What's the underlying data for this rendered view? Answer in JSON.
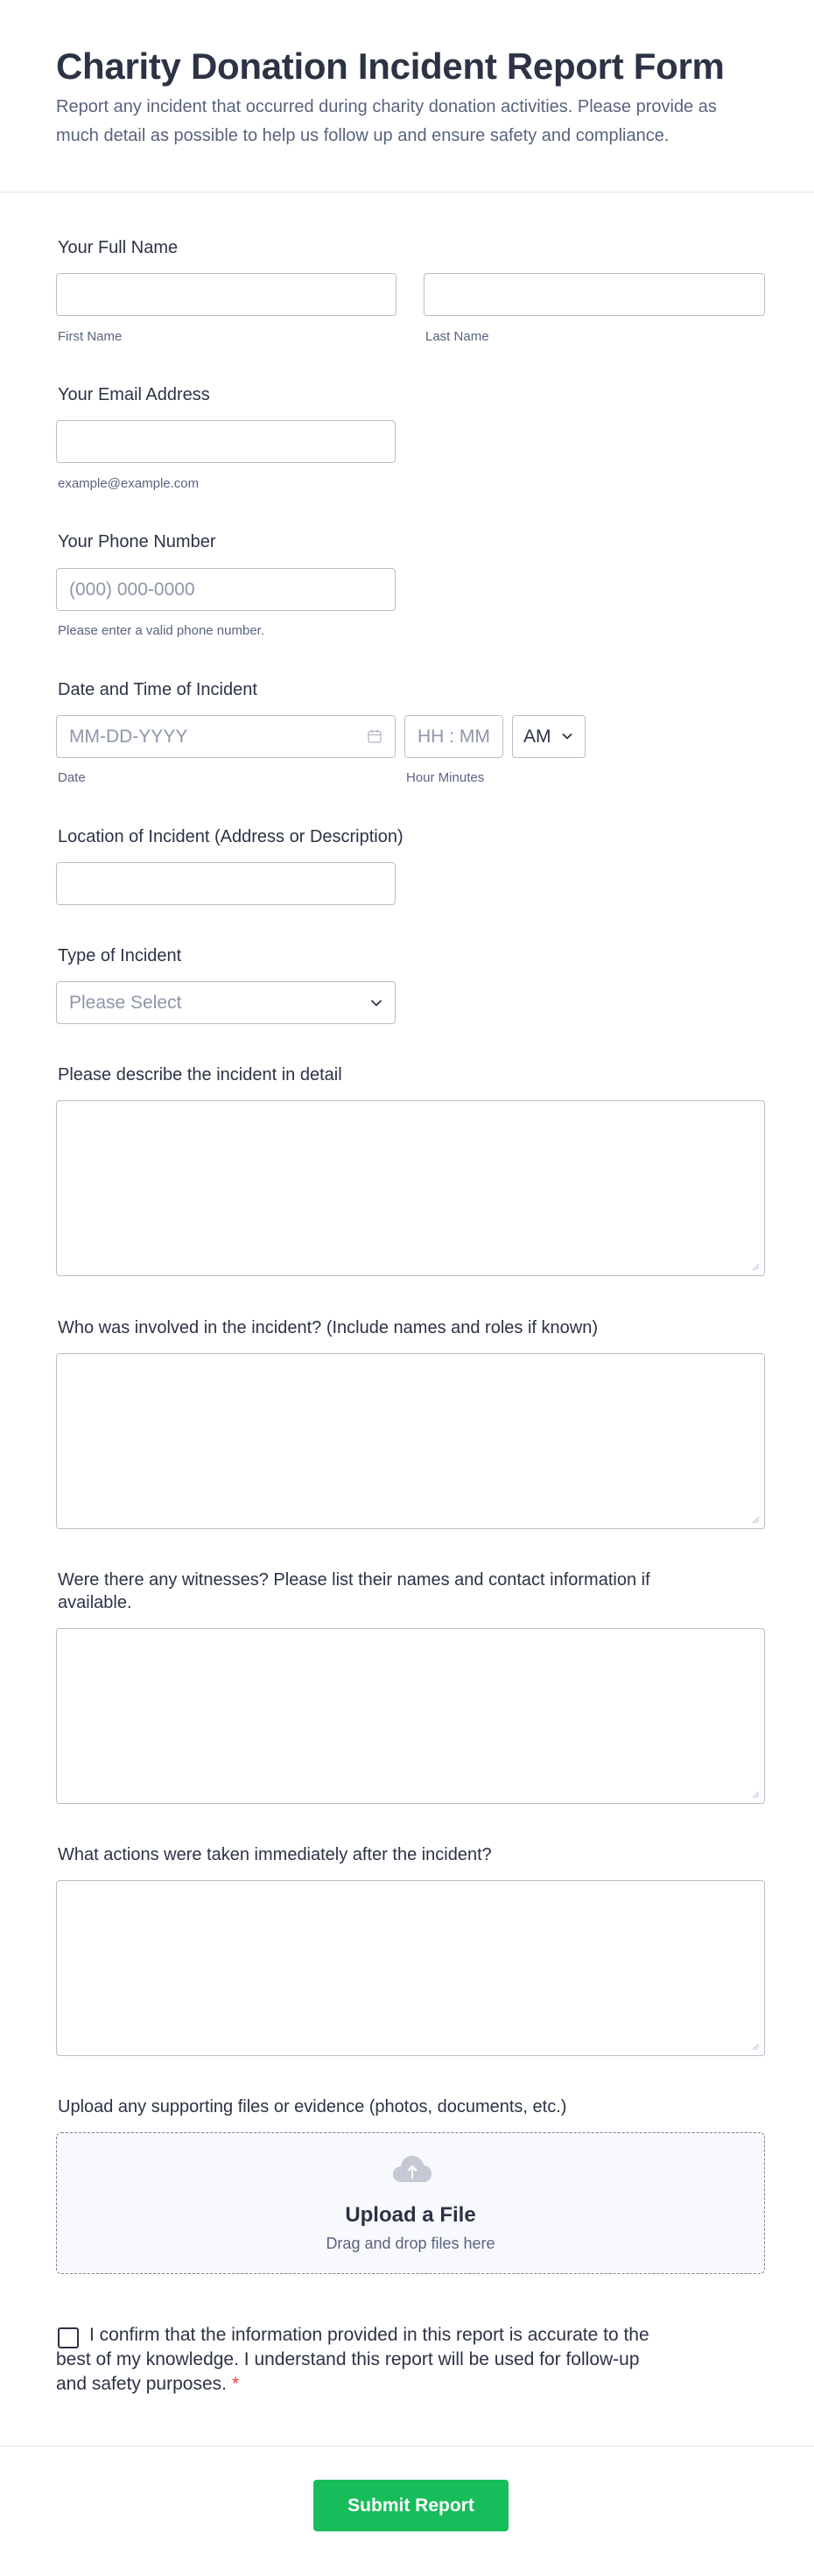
{
  "header": {
    "title": "Charity Donation Incident Report Form",
    "subtitle": "Report any incident that occurred during charity donation activities. Please provide as much detail as possible to help us follow up and ensure safety and compliance."
  },
  "name": {
    "label": "Your Full Name",
    "first_sublabel": "First Name",
    "last_sublabel": "Last Name",
    "first_value": "",
    "last_value": ""
  },
  "email": {
    "label": "Your Email Address",
    "sublabel": "example@example.com",
    "value": ""
  },
  "phone": {
    "label": "Your Phone Number",
    "placeholder": "(000) 000-0000",
    "sublabel": "Please enter a valid phone number."
  },
  "datetime": {
    "label": "Date and Time of Incident",
    "date_placeholder": "MM-DD-YYYY",
    "time_placeholder": "HH : MM",
    "ampm_value": "AM",
    "date_sublabel": "Date",
    "time_sublabel": "Hour Minutes"
  },
  "location": {
    "label": "Location of Incident (Address or Description)",
    "value": ""
  },
  "incident_type": {
    "label": "Type of Incident",
    "placeholder": "Please Select"
  },
  "describe": {
    "label": "Please describe the incident in detail"
  },
  "involved": {
    "label": "Who was involved in the incident? (Include names and roles if known)"
  },
  "witnesses": {
    "label": "Were there any witnesses? Please list their names and contact information if available."
  },
  "actions": {
    "label": "What actions were taken immediately after the incident?"
  },
  "upload": {
    "label": "Upload any supporting files or evidence (photos, documents, etc.)",
    "title": "Upload a File",
    "subtitle": "Drag and drop files here",
    "icon": "cloud-upload-icon"
  },
  "confirm": {
    "text": "I confirm that the information provided in this report is accurate to the best of my knowledge. I understand this report will be used for follow-up and safety purposes.",
    "required_mark": "*",
    "checked": false
  },
  "submit": {
    "label": "Submit Report"
  },
  "colors": {
    "primary_text": "#2c3345",
    "secondary_text": "#57647e",
    "border": "#b8bdc9",
    "submit": "#18bd5b",
    "required": "#f23a3c"
  }
}
